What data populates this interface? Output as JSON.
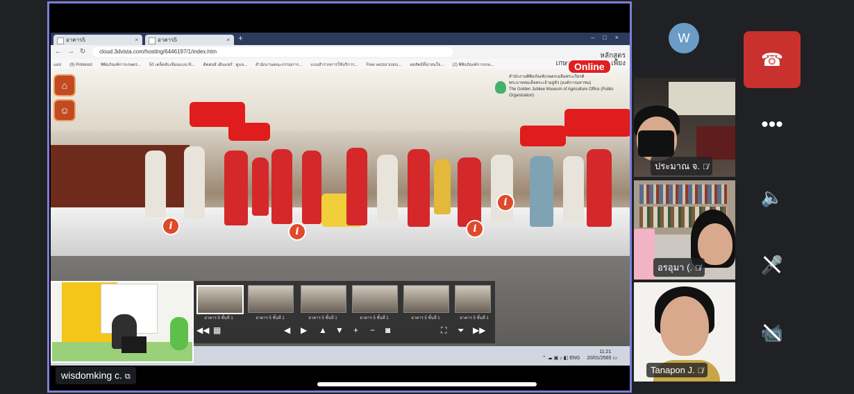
{
  "browser": {
    "tabs": [
      {
        "label": "อาคาร5"
      },
      {
        "label": "อาคาร5"
      }
    ],
    "url": "cloud.3dvista.com/hosting/6446197/1/index.htm",
    "bookmarks": [
      "แอป",
      "(9) Pinterest",
      "พิพิธภัณฑ์การเกษตร...",
      "50 เคล็ดลับเขียนแบบ R...",
      "ติดต่อส์ เดินแชร์ : ดูแล...",
      "สำนักงานคณะกรรมการ...",
      "แบบสำรวจการใช้บริการ...",
      "Free vector icons...",
      "ผลลัพธ์ที่น่าสนใจ...",
      "(2) พิพิธภัณฑ์การเกษ..."
    ]
  },
  "tour": {
    "brand_line1": "หลักสูตร",
    "brand_line2": "เกษตรเศรษฐกิจพอเพียง",
    "online_badge": "Online",
    "museum_line1": "สำนักงานพิพิธภัณฑ์เกษตรเฉลิมพระเกียรติ",
    "museum_line2": "พระบาทสมเด็จพระเจ้าอยู่หัว (องค์การมหาชน)",
    "museum_line3": "The Golden Jubilee Museum of Agriculture Office (Public Organization)",
    "info_icon": "i",
    "thumbnails": [
      "อาคาร 5 ชั้นที่ 1",
      "อาคาร 5 ชั้นที่ 1",
      "อาคาร 5 ชั้นที่ 1",
      "อาคาร 5 ชั้นที่ 1",
      "อาคาร 5 ชั้นที่ 1",
      "อาคาร 5 ชั้นที่ 1"
    ]
  },
  "taskbar": {
    "language": "ENG",
    "time": "11:21",
    "date": "20/01/2565"
  },
  "main_tile": {
    "presenter_name": "wisdomking c."
  },
  "participants": [
    {
      "name": "ประมาณ จ.",
      "avatar_initial": "W"
    },
    {
      "name": "อรอุมา (."
    },
    {
      "name": "Tanapon J."
    }
  ],
  "controls": {
    "end_call_icon": "phone-hangup-icon",
    "more_icon": "more-dots-icon",
    "speaker_icon": "speaker-bluetooth-icon",
    "mic_icon": "mic-off-icon",
    "camera_icon": "camera-off-icon"
  },
  "colors": {
    "share_border": "#7b7fd8",
    "end_call": "#c8312e",
    "online_badge": "#e02020",
    "info_marker": "#e0492a"
  }
}
